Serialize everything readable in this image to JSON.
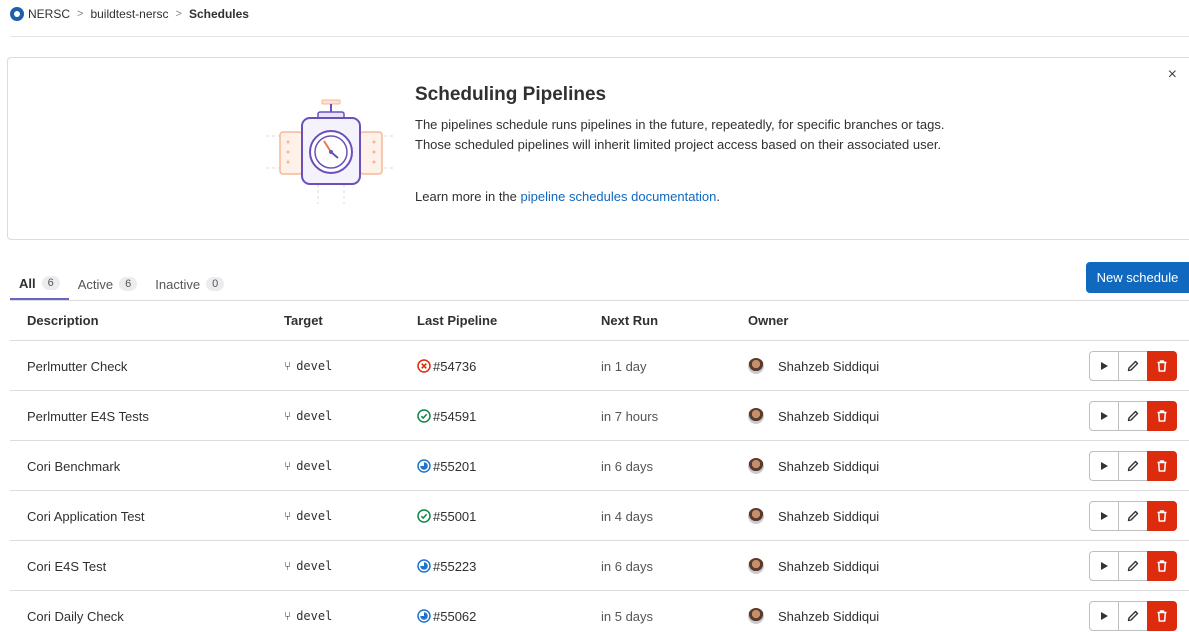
{
  "breadcrumb": {
    "org": "NERSC",
    "project": "buildtest-nersc",
    "current": "Schedules"
  },
  "banner": {
    "title": "Scheduling Pipelines",
    "body": "The pipelines schedule runs pipelines in the future, repeatedly, for specific branches or tags. Those scheduled pipelines will inherit limited project access based on their associated user.",
    "learn_prefix": "Learn more in the",
    "learn_link": "pipeline schedules documentation",
    "learn_suffix": ".",
    "close_icon": "×"
  },
  "tabs": [
    {
      "label": "All",
      "count": "6"
    },
    {
      "label": "Active",
      "count": "6"
    },
    {
      "label": "Inactive",
      "count": "0"
    }
  ],
  "new_schedule_label": "New schedule",
  "table": {
    "headers": {
      "description": "Description",
      "target": "Target",
      "last_pipeline": "Last Pipeline",
      "next_run": "Next Run",
      "owner": "Owner"
    },
    "rows": [
      {
        "description": "Perlmutter Check",
        "target": "devel",
        "pipeline": "#54736",
        "status": "failed",
        "next_run": "in 1 day",
        "owner": "Shahzeb Siddiqui"
      },
      {
        "description": "Perlmutter E4S Tests",
        "target": "devel",
        "pipeline": "#54591",
        "status": "passed",
        "next_run": "in 7 hours",
        "owner": "Shahzeb Siddiqui"
      },
      {
        "description": "Cori Benchmark",
        "target": "devel",
        "pipeline": "#55201",
        "status": "running",
        "next_run": "in 6 days",
        "owner": "Shahzeb Siddiqui"
      },
      {
        "description": "Cori Application Test",
        "target": "devel",
        "pipeline": "#55001",
        "status": "passed",
        "next_run": "in 4 days",
        "owner": "Shahzeb Siddiqui"
      },
      {
        "description": "Cori E4S Test",
        "target": "devel",
        "pipeline": "#55223",
        "status": "running",
        "next_run": "in 6 days",
        "owner": "Shahzeb Siddiqui"
      },
      {
        "description": "Cori Daily Check",
        "target": "devel",
        "pipeline": "#55062",
        "status": "running",
        "next_run": "in 5 days",
        "owner": "Shahzeb Siddiqui"
      }
    ]
  },
  "colors": {
    "primary": "#1068bf",
    "danger": "#dd2b0e",
    "success": "#108548",
    "tab_underline": "#6666c4"
  }
}
